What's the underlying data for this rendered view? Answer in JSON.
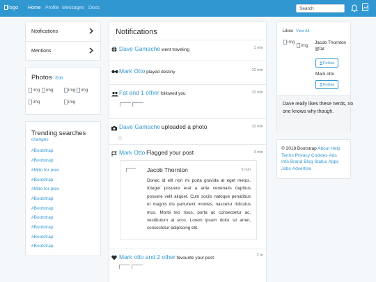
{
  "navbar": {
    "logo_alt": "logo",
    "links": [
      "Home",
      "Profile",
      "Messages",
      "Docs"
    ],
    "search_placeholder": "Search"
  },
  "sidebar": {
    "menu": [
      "Notifications",
      "Mentions"
    ],
    "photos": {
      "title": "Photos",
      "edit": "Edit",
      "img_alt": "img"
    },
    "trending": {
      "title": "Trending searches",
      "changes": "changes",
      "items": [
        "#Bootstrap",
        "#Bootstrap",
        "#Mdo for pres",
        "#Bootstrap",
        "#Mdo for pres",
        "#Bootstrap",
        "#Bootstrap",
        "#Bootstrap",
        "#Bootstrap",
        "#Bootstrap",
        "#Bootstrap"
      ]
    }
  },
  "notifications": {
    "title": "Notifications",
    "items": [
      {
        "icon": "globe-icon",
        "name": "Dave Gamache",
        "text": "went traveling",
        "time": "1 min"
      },
      {
        "icon": "glasses-icon",
        "name": "Mark Otto",
        "text": "played destiny",
        "time": "10 min"
      },
      {
        "icon": "users-icon",
        "name": "Fat and 1 other",
        "text": "followed you",
        "time": "10 min"
      },
      {
        "icon": "camera-icon",
        "name": "Dave Gamache",
        "text": "uploaded a photo",
        "time": "10 min"
      },
      {
        "icon": "flag-icon",
        "name": "Mark Otto",
        "text": "Flagged your post",
        "time": "3 min"
      },
      {
        "icon": "heart-icon",
        "name": "Mark otto and 2 other",
        "text": "favourite your post",
        "time": "2 hr"
      }
    ],
    "quote": {
      "name": "Jacob Thornton",
      "time": "5 min",
      "body": "Donec id elit non mi porta gravida at eget metus. Integer posuere erat a ante venenatis dapibus posuere velit aliquet. Cum sociis natoque penatibus et magnis dis parturient montes, nascetur ridiculus mus. Morbi leo risus, porta ac consectetur ac, vestibulum at eros. Lorem ipsum dolor sit amet, consectetur adipiscing elit."
    }
  },
  "likes": {
    "title": "Likes",
    "view_all": "View All",
    "img_alt": "img",
    "people": [
      {
        "name": "Jacob Thornton @fat",
        "follow": "Follow"
      },
      {
        "name": "Mark otto",
        "follow": "Follow"
      }
    ],
    "quote": "Dave really likes these nerds, no one knows why though."
  },
  "footer": {
    "copyright": "© 2018 Bootstrap",
    "links": [
      "About",
      "Help",
      "Terms",
      "Privacy",
      "Cookies",
      "Ads",
      "Info",
      "Brand",
      "Blog",
      "Status",
      "Apps",
      "Jobs",
      "Advertise"
    ]
  }
}
